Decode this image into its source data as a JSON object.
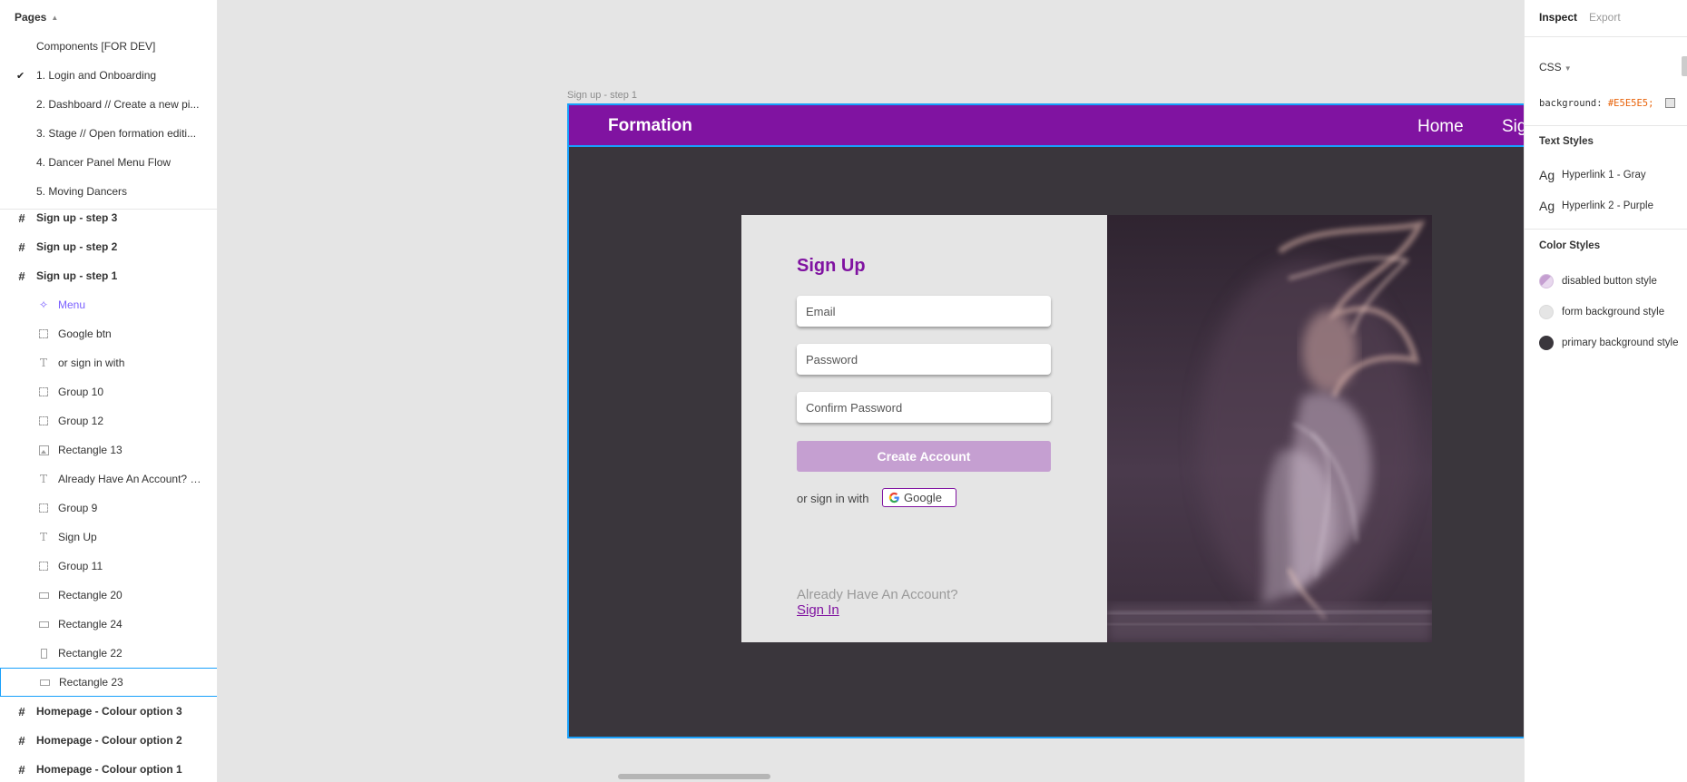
{
  "pages_panel": {
    "title": "Pages",
    "pages": [
      {
        "label": "Components [FOR DEV]",
        "checked": false
      },
      {
        "label": "1. Login and Onboarding",
        "checked": true
      },
      {
        "label": "2. Dashboard // Create a new pi...",
        "checked": false
      },
      {
        "label": "3. Stage // Open formation editi...",
        "checked": false
      },
      {
        "label": "4. Dancer Panel Menu Flow",
        "checked": false
      },
      {
        "label": "5. Moving Dancers",
        "checked": false
      }
    ]
  },
  "layers": [
    {
      "label": "Sign up - step 3",
      "kind": "frame",
      "icon": "frame-icon"
    },
    {
      "label": "Sign up - step 2",
      "kind": "frame",
      "icon": "frame-icon"
    },
    {
      "label": "Sign up - step 1",
      "kind": "frame",
      "icon": "frame-icon"
    },
    {
      "label": "Menu",
      "kind": "component",
      "icon": "component-instance-icon"
    },
    {
      "label": "Google btn",
      "kind": "group",
      "icon": "group-icon"
    },
    {
      "label": "or sign in with",
      "kind": "text",
      "icon": "text-icon"
    },
    {
      "label": "Group 10",
      "kind": "group",
      "icon": "group-icon"
    },
    {
      "label": "Group 12",
      "kind": "group",
      "icon": "group-icon"
    },
    {
      "label": "Rectangle 13",
      "kind": "image",
      "icon": "image-icon"
    },
    {
      "label": "Already Have An Account? Si...",
      "kind": "text",
      "icon": "text-icon"
    },
    {
      "label": "Group 9",
      "kind": "group",
      "icon": "group-icon"
    },
    {
      "label": "Sign Up",
      "kind": "text",
      "icon": "text-icon"
    },
    {
      "label": "Group 11",
      "kind": "group",
      "icon": "group-icon"
    },
    {
      "label": "Rectangle 20",
      "kind": "rect",
      "icon": "rectangle-icon"
    },
    {
      "label": "Rectangle 24",
      "kind": "rect",
      "icon": "rectangle-icon"
    },
    {
      "label": "Rectangle 22",
      "kind": "rect-v",
      "icon": "rectangle-icon"
    },
    {
      "label": "Rectangle 23",
      "kind": "rect",
      "icon": "rectangle-icon",
      "selected": true
    },
    {
      "label": "Homepage - Colour option 3",
      "kind": "frame",
      "icon": "frame-icon"
    },
    {
      "label": "Homepage - Colour option 2",
      "kind": "frame",
      "icon": "frame-icon"
    },
    {
      "label": "Homepage - Colour option 1",
      "kind": "frame",
      "icon": "frame-icon"
    }
  ],
  "canvas": {
    "frame_label": "Sign up - step 1",
    "nav": {
      "brand": "Formation",
      "home": "Home",
      "sign_in": "Sign In"
    },
    "form": {
      "title": "Sign Up",
      "email_placeholder": "Email",
      "password_placeholder": "Password",
      "confirm_placeholder": "Confirm Password",
      "create_button": "Create Account",
      "or_sign_in_with": "or sign in with",
      "google_label": "Google",
      "already_have": "Already Have An Account?",
      "sign_in_link": "Sign In"
    }
  },
  "inspect": {
    "tabs": {
      "inspect": "Inspect",
      "export": "Export"
    },
    "code_mode": "CSS",
    "code_property": "background: ",
    "code_value": "#E5E5E5;",
    "text_styles_title": "Text Styles",
    "text_styles": [
      {
        "preview": "Ag",
        "label": "Hyperlink 1 - Gray"
      },
      {
        "preview": "Ag",
        "label": "Hyperlink 2 - Purple"
      }
    ],
    "color_styles_title": "Color Styles",
    "color_styles": [
      {
        "label": "disabled button style",
        "color": "#C59FD1"
      },
      {
        "label": "form background style",
        "color": "#E5E5E5"
      },
      {
        "label": "primary background style",
        "color": "#3A363C"
      }
    ]
  },
  "colors": {
    "brand_purple": "#8013A1",
    "selection_blue": "#18A0FB",
    "frame_background": "#3A363C",
    "form_background": "#E5E5E5"
  }
}
